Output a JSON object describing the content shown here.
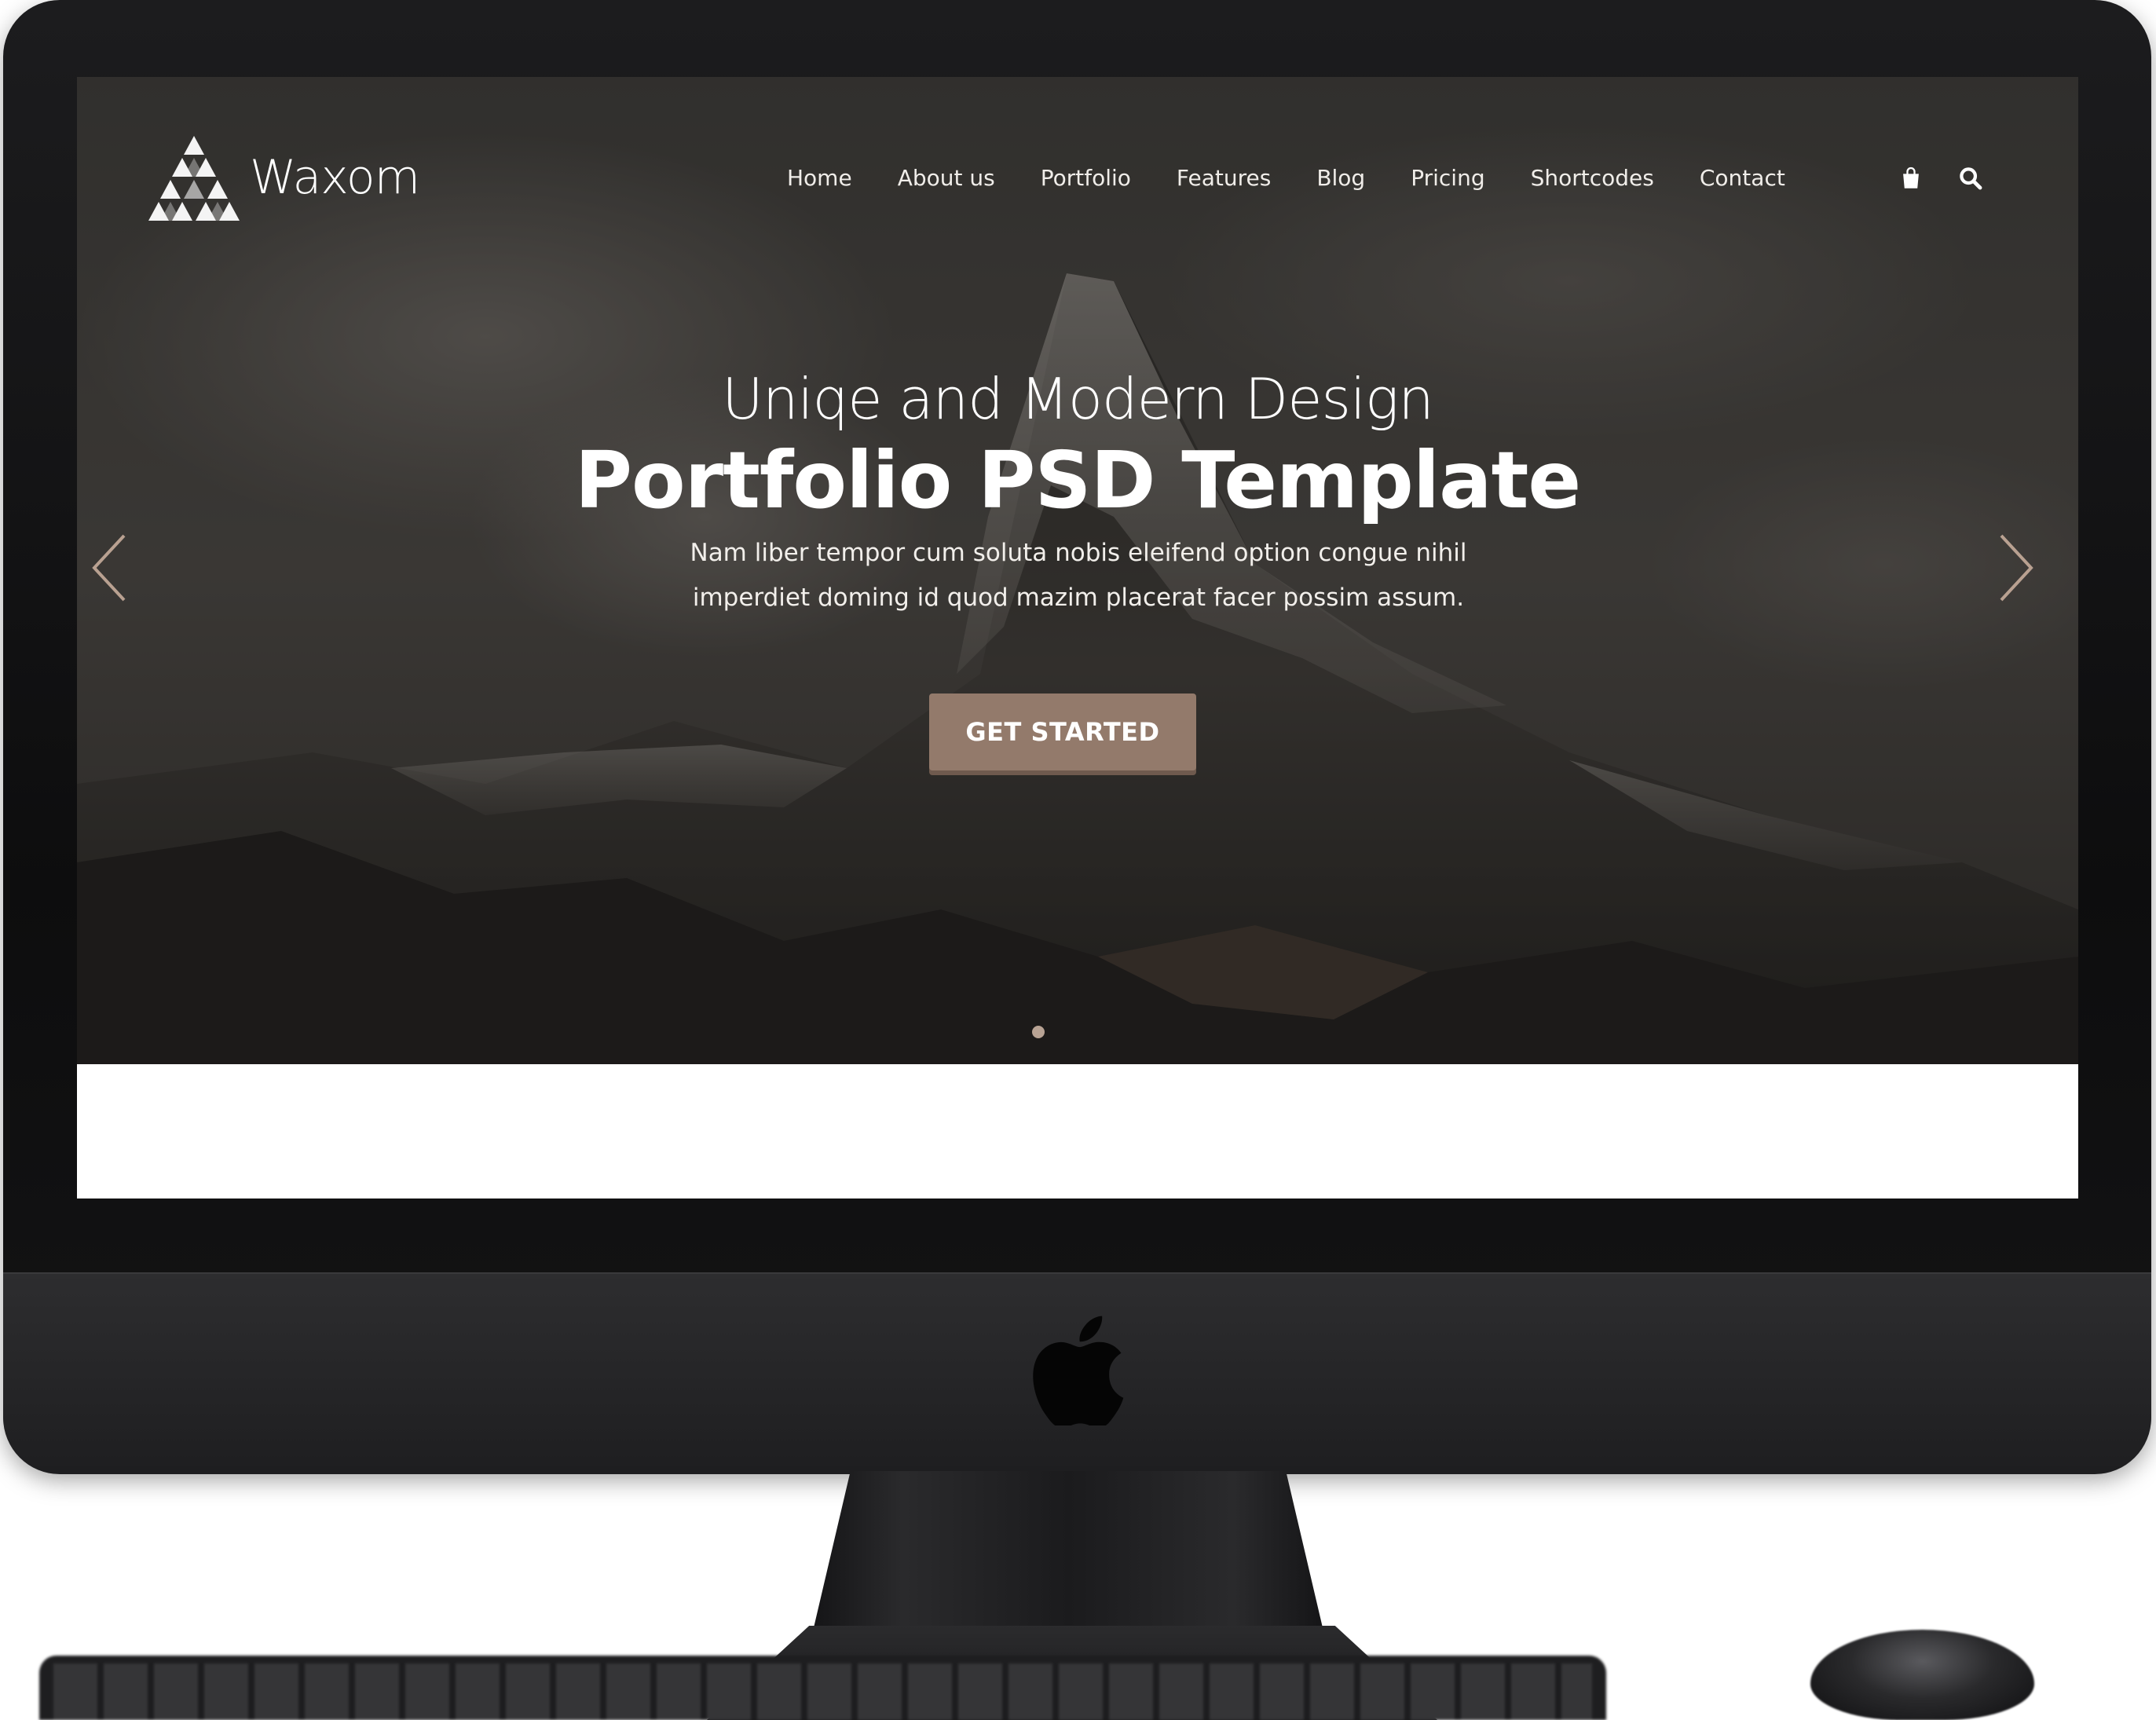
{
  "brand": {
    "name": "Waxom"
  },
  "nav": {
    "items": [
      "Home",
      "About us",
      "Portfolio",
      "Features",
      "Blog",
      "Pricing",
      "Shortcodes",
      "Contact"
    ],
    "icons": [
      "shopping-bag-icon",
      "search-icon"
    ]
  },
  "hero": {
    "subtitle": "Uniqe and Modern Design",
    "title": "Portfolio PSD Template",
    "description_line1": "Nam liber tempor cum soluta nobis eleifend option congue nihil",
    "description_line2": "imperdiet doming id quod mazim placerat facer possim assum.",
    "cta_label": "GET STARTED",
    "slider": {
      "total_slides": 1,
      "active_slide": 1
    }
  },
  "colors": {
    "accent": "#937a6b",
    "accent_shadow": "#6f5a4e",
    "arrow": "#b9a191",
    "device_dark": "#151517"
  }
}
